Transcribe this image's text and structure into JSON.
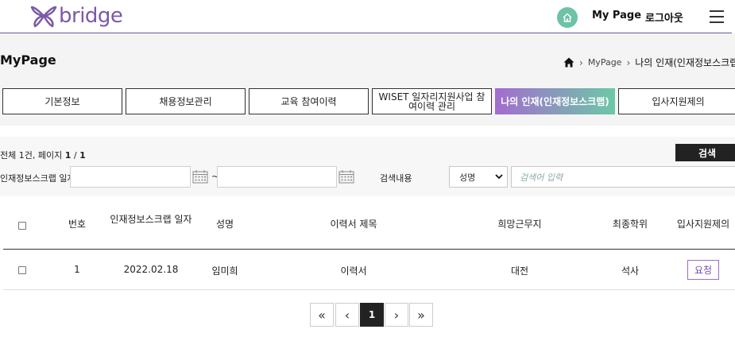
{
  "header": {
    "logo_text": "bridge",
    "mypage_link": "My Page",
    "logout_link": "로그아웃"
  },
  "page": {
    "title": "MyPage",
    "breadcrumb": [
      "MyPage",
      "나의 인재(인재정보스크랩)"
    ]
  },
  "tabs": [
    {
      "label": "기본정보",
      "active": false
    },
    {
      "label": "채용정보관리",
      "active": false
    },
    {
      "label": "교육 참여이력",
      "active": false
    },
    {
      "label": "WISET 일자리지원사업 참여이력 관리",
      "active": false
    },
    {
      "label": "나의 인재(인재정보스크랩)",
      "active": true
    },
    {
      "label": "입사지원제의",
      "active": false
    }
  ],
  "search": {
    "count_prefix": "전체 ",
    "count_value": "1",
    "count_mid": "건, 페이지 ",
    "page_current": "1",
    "page_sep": " / ",
    "page_total": "1",
    "button_label": "검색",
    "date_label": "인재정보스크랩 일자",
    "date_from_value": "",
    "date_to_value": "",
    "tilde": "~",
    "content_label": "검색내용",
    "select_value": "성명",
    "keyword_placeholder": "검색어 입력"
  },
  "table": {
    "headers": {
      "no": "번호",
      "date": "인재정보스크랩 일자",
      "name": "성명",
      "resume_title": "이력서 제목",
      "location": "희망근무지",
      "degree": "최종학위",
      "offer": "입사지원제의"
    },
    "rows": [
      {
        "no": "1",
        "date": "2022.02.18",
        "name": "임미희",
        "resume_title": "이력서",
        "location": "대전",
        "degree": "석사",
        "offer": "요청"
      }
    ]
  },
  "pagination": {
    "first": "«",
    "prev": "‹",
    "current": "1",
    "next": "›",
    "last": "»"
  },
  "colors": {
    "brand_purple": "#7a5aa6",
    "home_green": "#6cc3a5",
    "tab_gradient_start": "#a36ccf",
    "tab_gradient_end": "#6dc8a6"
  }
}
